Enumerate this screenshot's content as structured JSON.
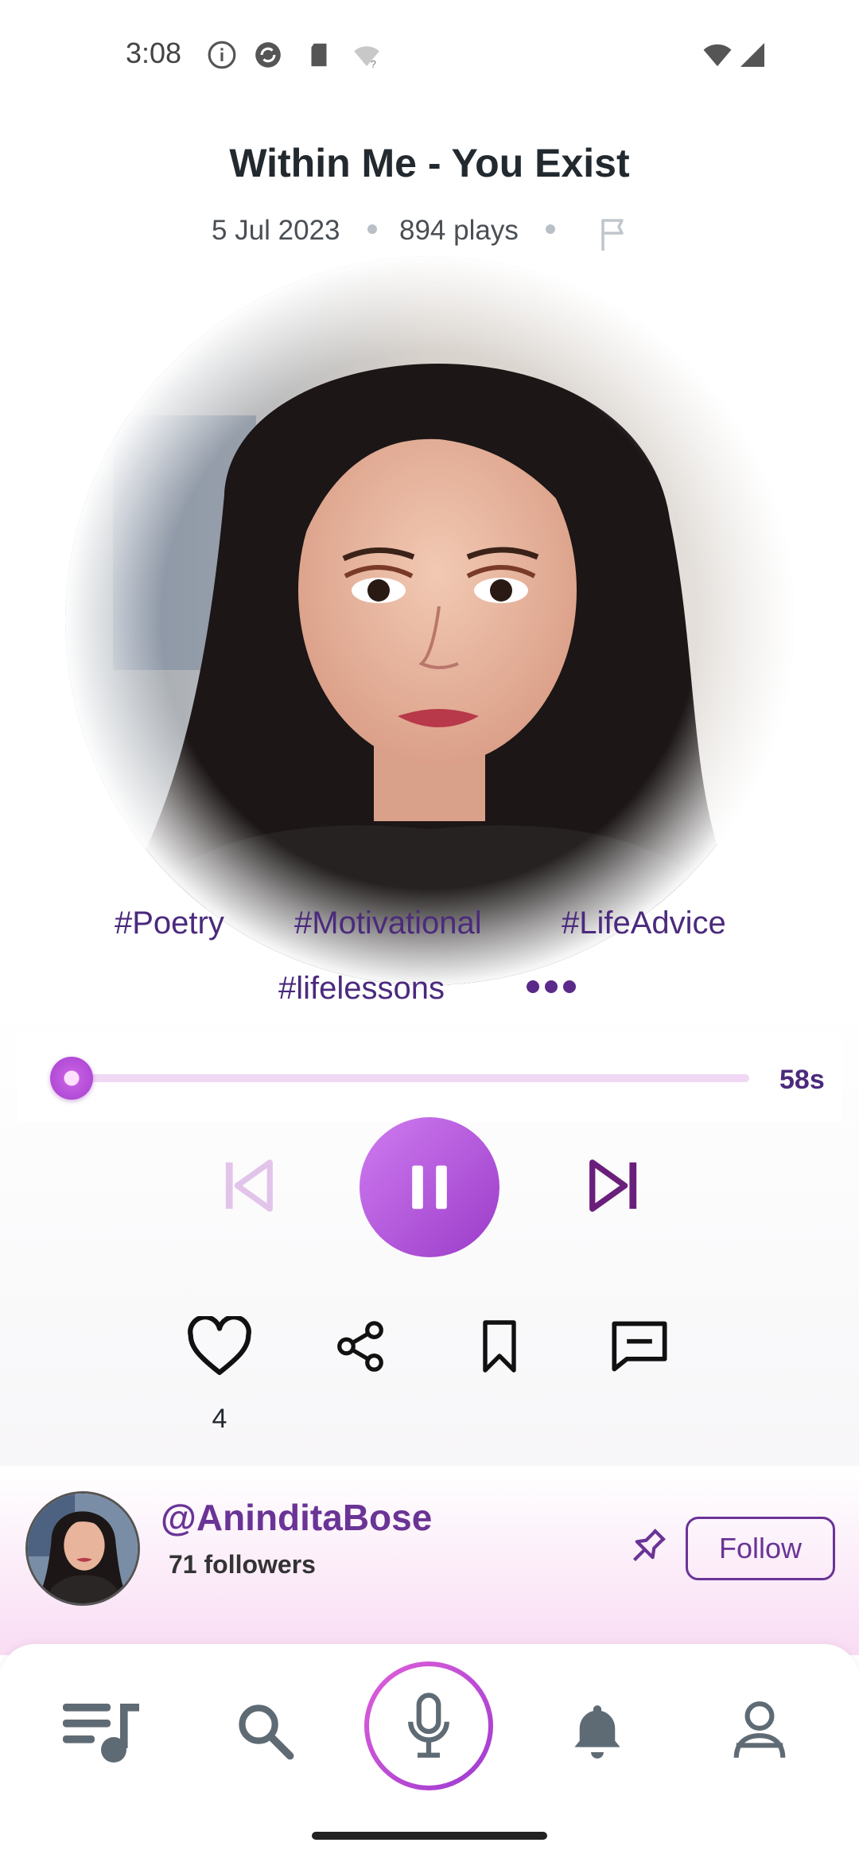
{
  "status_bar": {
    "time": "3:08",
    "icons_left": [
      "info-icon",
      "sync-icon",
      "sd-card-icon",
      "wifi-question-icon"
    ],
    "icons_right": [
      "wifi-icon",
      "signal-icon"
    ]
  },
  "track": {
    "title": "Within Me - You Exist",
    "date": "5 Jul 2023",
    "plays": "894 plays"
  },
  "tags": [
    "#Poetry",
    "#Motivational",
    "#LifeAdvice",
    "#lifelessons"
  ],
  "player": {
    "progress": 0.02,
    "remaining": "58s",
    "state": "playing"
  },
  "actions": {
    "likes": "4"
  },
  "author": {
    "handle": "@AninditaBose",
    "followers": "71 followers",
    "follow_label": "Follow"
  },
  "bottom_nav": [
    "playlist-icon",
    "search-icon",
    "mic-icon",
    "bell-icon",
    "profile-icon"
  ],
  "colors": {
    "accent_purple": "#6a3496",
    "play_gradient_start": "#cf7bf0",
    "play_gradient_end": "#9b3cc9",
    "seek_track": "#f0d8f5"
  }
}
